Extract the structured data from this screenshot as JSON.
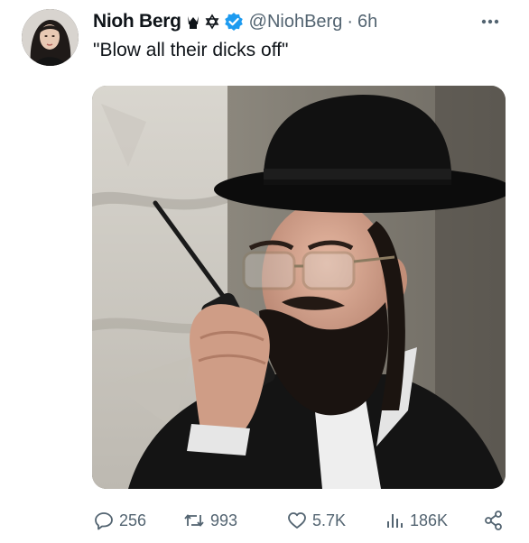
{
  "author": {
    "display_name": "Nioh Berg",
    "handle": "@NiohBerg",
    "separator": "·",
    "time": "6h",
    "badges": [
      "crown-icon",
      "star-of-david-icon",
      "verified-badge-icon"
    ],
    "verified_color": "#1d9bf0"
  },
  "tweet": {
    "text": "\"Blow all their dicks off\""
  },
  "actions": {
    "replies": "256",
    "retweets": "993",
    "likes": "5.7K",
    "views": "186K"
  },
  "colors": {
    "text_primary": "#0f1419",
    "text_secondary": "#536471",
    "accent": "#1d9bf0"
  }
}
